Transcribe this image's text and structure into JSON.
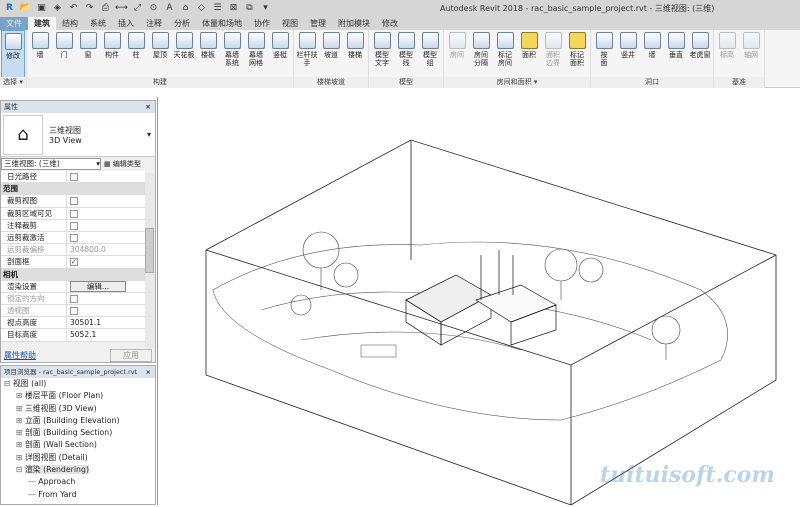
{
  "window": {
    "title": "Autodesk Revit 2018 -     rac_basic_sample_project.rvt - 三维视图: (三维)"
  },
  "tabs": [
    "文件",
    "建筑",
    "结构",
    "系统",
    "插入",
    "注释",
    "分析",
    "体量和场地",
    "协作",
    "视图",
    "管理",
    "附加模块",
    "修改"
  ],
  "ribbon": {
    "select": {
      "button": "修改",
      "label": "选择 ▾"
    },
    "build": {
      "label": "构建",
      "buttons": [
        "墙",
        "门",
        "窗",
        "构件",
        "柱",
        "屋顶",
        "天花板",
        "楼板",
        "幕墙\n系统",
        "幕墙\n网格",
        "竖梃"
      ]
    },
    "stairs": {
      "label": "楼梯坡道",
      "buttons": [
        "栏杆扶手",
        "坡道",
        "楼梯"
      ]
    },
    "model": {
      "label": "模型",
      "buttons": [
        "模型\n文字",
        "模型\n线",
        "模型\n组"
      ]
    },
    "room": {
      "label": "房间和面积 ▾",
      "buttons": [
        "房间",
        "房间\n分隔",
        "标记\n房间",
        "面积",
        "面积\n边界",
        "标记\n面积"
      ]
    },
    "opening": {
      "label": "洞口",
      "buttons": [
        "按\n面",
        "竖井",
        "墙",
        "垂直",
        "老虎窗"
      ]
    },
    "datum": {
      "label": "基准",
      "buttons": [
        "标高",
        "轴网"
      ]
    }
  },
  "properties": {
    "header": "属性",
    "type_name": "三维视图",
    "type_en": "3D View",
    "instance": "三维视图: (三维)",
    "edit_type": "编辑类型",
    "rows": [
      {
        "k": "日光路径",
        "v": "",
        "cb": " "
      },
      {
        "group": "范围"
      },
      {
        "k": "裁剪视图",
        "v": "",
        "cb": " "
      },
      {
        "k": "裁剪区域可见",
        "v": "",
        "cb": " "
      },
      {
        "k": "注释裁剪",
        "v": "",
        "cb": " "
      },
      {
        "k": "远剪裁激活",
        "v": "",
        "cb": " "
      },
      {
        "k": "远剪裁偏移",
        "v": "304800.0",
        "dim": true
      },
      {
        "k": "剖面框",
        "v": "",
        "cb": "✓"
      },
      {
        "group": "相机"
      },
      {
        "k": "渲染设置",
        "v": "编辑..."
      },
      {
        "k": "锁定的方向",
        "v": "",
        "cb": " ",
        "dim": true
      },
      {
        "k": "透视图",
        "v": "",
        "cb": " ",
        "dim": true
      },
      {
        "k": "视点高度",
        "v": "30501.1"
      },
      {
        "k": "目标高度",
        "v": "5052.1"
      }
    ],
    "help": "属性帮助",
    "apply": "应用"
  },
  "browser": {
    "header": "项目浏览器 - rac_basic_sample_project.rvt",
    "nodes": [
      {
        "t": "视图 (all)",
        "l": 0,
        "s": "⊟"
      },
      {
        "t": "楼层平面 (Floor Plan)",
        "l": 1,
        "s": "⊞"
      },
      {
        "t": "三维视图 (3D View)",
        "l": 1,
        "s": "⊞"
      },
      {
        "t": "立面 (Building Elevation)",
        "l": 1,
        "s": "⊞"
      },
      {
        "t": "剖面 (Building Section)",
        "l": 1,
        "s": "⊞"
      },
      {
        "t": "剖面 (Wall Section)",
        "l": 1,
        "s": "⊞"
      },
      {
        "t": "详图视图 (Detail)",
        "l": 1,
        "s": "⊞"
      },
      {
        "t": "渲染 (Rendering)",
        "l": 1,
        "s": "⊟"
      },
      {
        "t": "Approach",
        "l": 2,
        "s": ""
      },
      {
        "t": "From Yard",
        "l": 2,
        "s": ""
      }
    ]
  },
  "watermark": "tuituisoft.com"
}
